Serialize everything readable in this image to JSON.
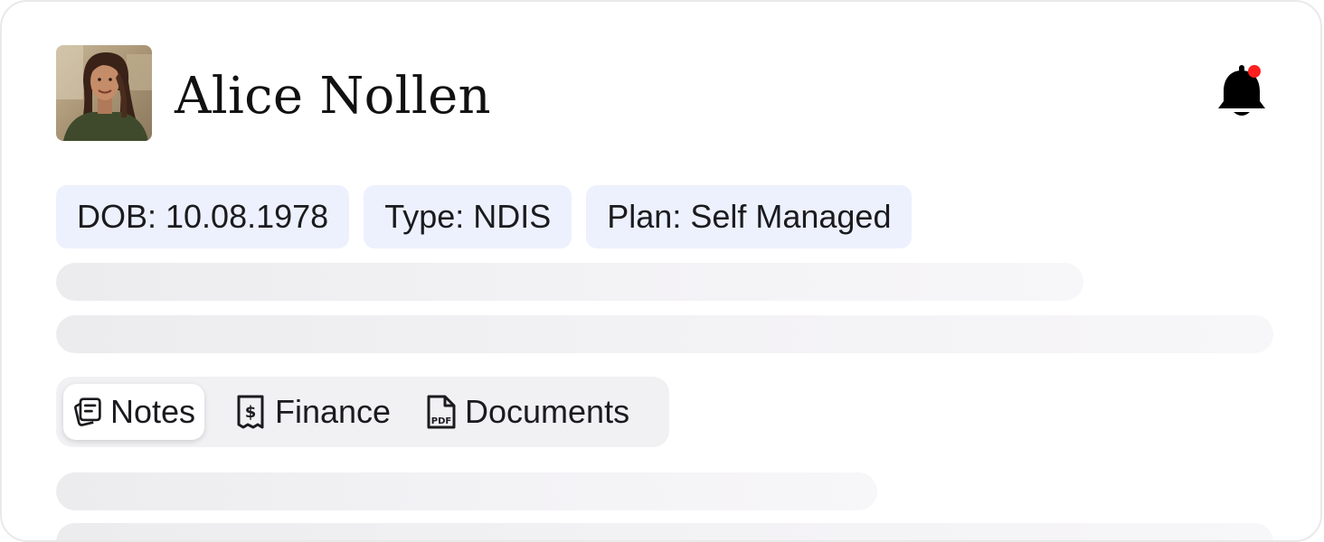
{
  "profile": {
    "name": "Alice Nollen",
    "avatar_alt": "profile photo"
  },
  "notification": {
    "icon": "bell-icon",
    "has_unread": true,
    "dot_color": "#ff1f1f"
  },
  "chips": [
    {
      "label": "DOB: 10.08.1978"
    },
    {
      "label": "Type: NDIS"
    },
    {
      "label": "Plan: Self Managed"
    }
  ],
  "tabs": [
    {
      "label": "Notes",
      "icon": "notes-icon",
      "active": true
    },
    {
      "label": "Finance",
      "icon": "receipt-dollar-icon",
      "active": false
    },
    {
      "label": "Documents",
      "icon": "pdf-file-icon",
      "active": false
    }
  ],
  "colors": {
    "chip_bg": "#edf1fd",
    "tab_bar_bg": "#f1f0f3",
    "skeleton": "#ececee",
    "text": "#1b1b1f"
  }
}
